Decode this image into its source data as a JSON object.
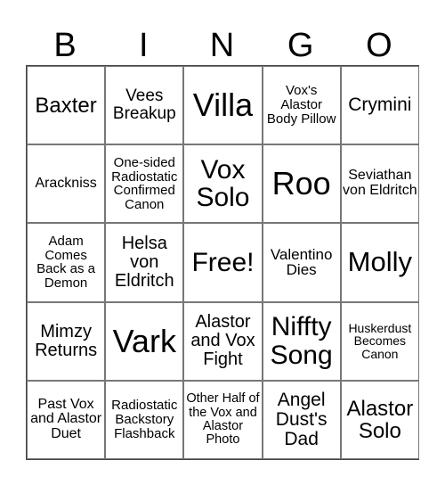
{
  "header": [
    "B",
    "I",
    "N",
    "G",
    "O"
  ],
  "cells": [
    "Baxter",
    "Vees Breakup",
    "Villa",
    "Vox's Alastor Body Pillow",
    "Crymini",
    "Arackniss",
    "One-sided Radiostatic Confirmed Canon",
    "Vox Solo",
    "Roo",
    "Seviathan von Eldritch",
    "Adam Comes Back as a Demon",
    "Helsa von Eldritch",
    "Free!",
    "Valentino Dies",
    "Molly",
    "Mimzy Returns",
    "Vark",
    "Alastor and Vox Fight",
    "Niffty Song",
    "Huskerdust Becomes Canon",
    "Past Vox and Alastor Duet",
    "Radiostatic Backstory Flashback",
    "Other Half of the Vox and Alastor Photo",
    "Angel Dust's Dad",
    "Alastor Solo"
  ]
}
